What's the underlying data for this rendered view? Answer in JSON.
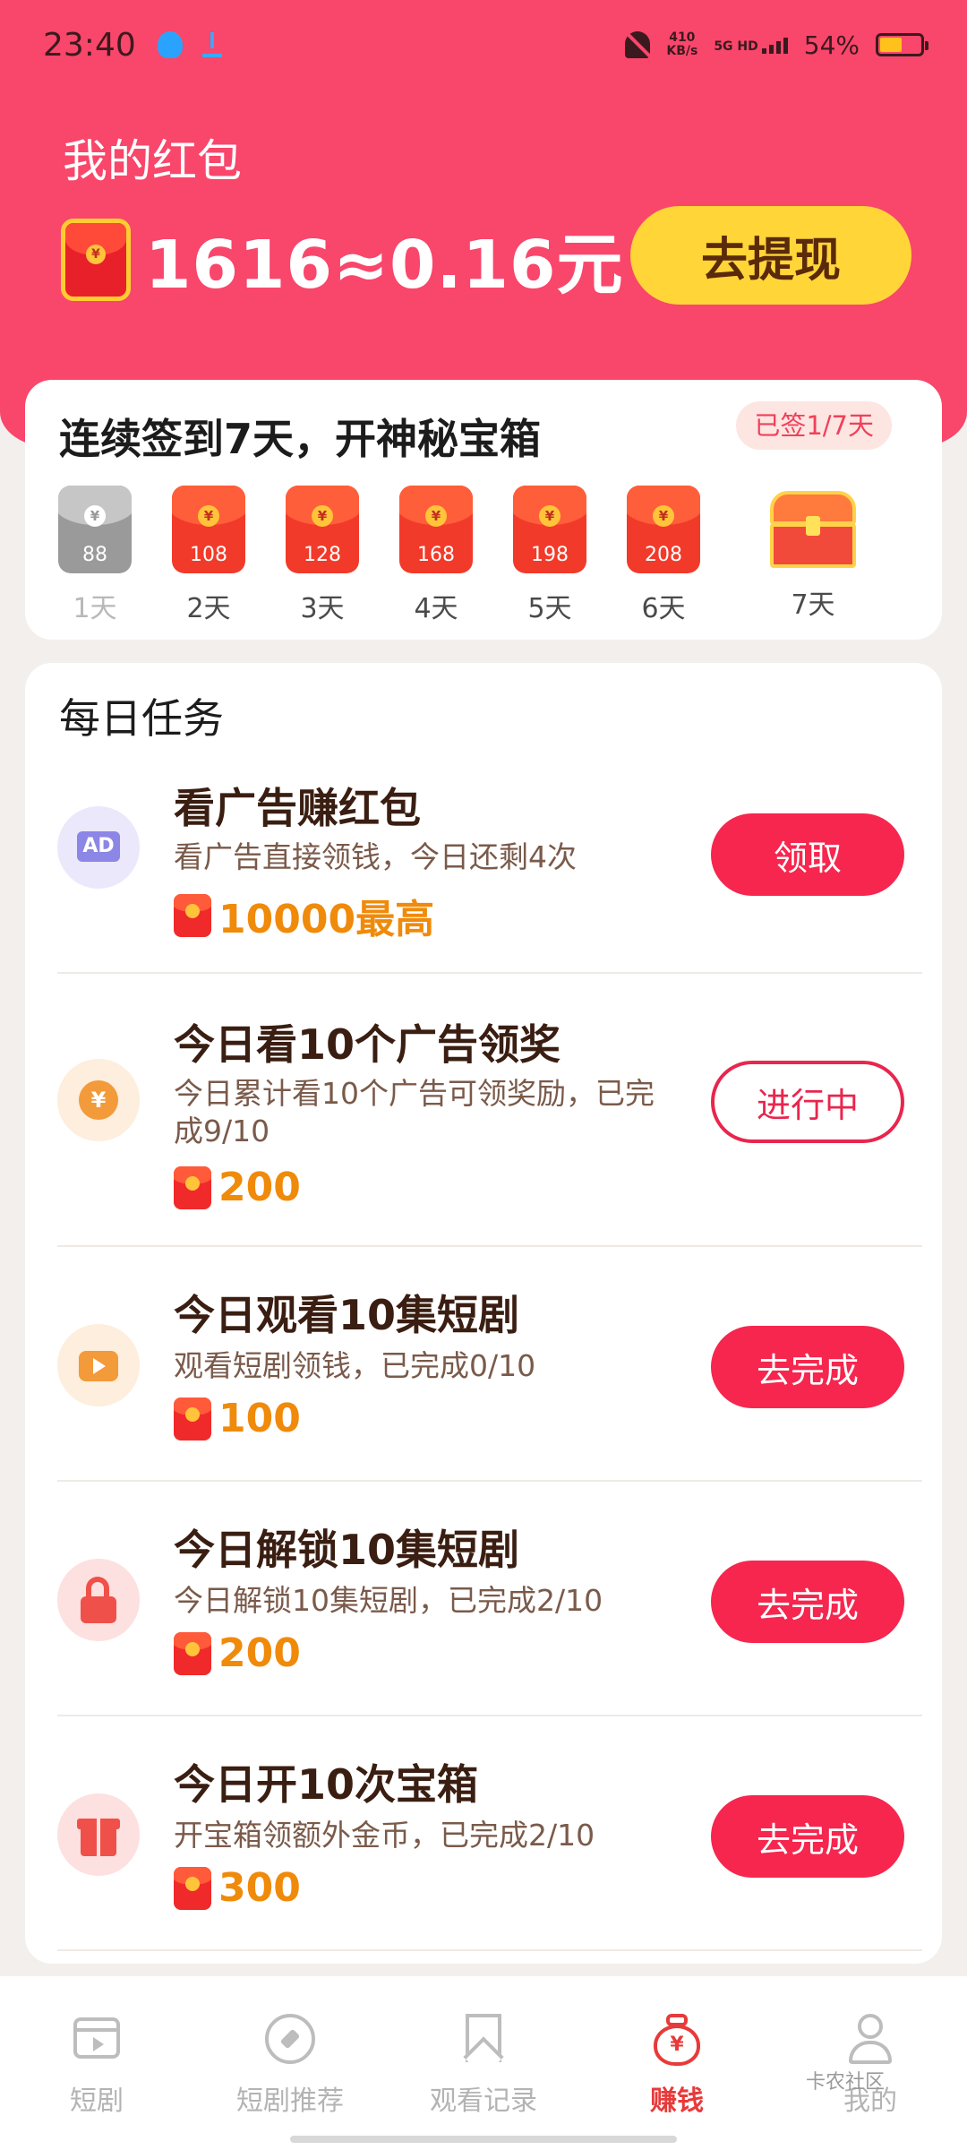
{
  "status_bar": {
    "time": "23:40",
    "net_speed_top": "410",
    "net_speed_bottom": "KB/s",
    "signal": "5G HD",
    "battery": "54%"
  },
  "wallet": {
    "title": "我的红包",
    "amount": "1616≈0.16元",
    "withdraw_label": "去提现"
  },
  "checkin": {
    "title": "连续签到7天，开神秘宝箱",
    "badge": "已签1/7天",
    "days": [
      {
        "value": "88",
        "label": "1天"
      },
      {
        "value": "108",
        "label": "2天"
      },
      {
        "value": "128",
        "label": "3天"
      },
      {
        "value": "168",
        "label": "4天"
      },
      {
        "value": "198",
        "label": "5天"
      },
      {
        "value": "208",
        "label": "6天"
      },
      {
        "value": "",
        "label": "7天"
      }
    ]
  },
  "tasks": {
    "title": "每日任务",
    "items": [
      {
        "name": "看广告赚红包",
        "desc": "看广告直接领钱，今日还剩4次",
        "reward": "10000最高",
        "button": "领取",
        "icon": "ad-icon"
      },
      {
        "name": "今日看10个广告领奖",
        "desc": "今日累计看10个广告可领奖励，已完成9/10",
        "reward": "200",
        "button": "进行中",
        "icon": "yen-coin-icon"
      },
      {
        "name": "今日观看10集短剧",
        "desc": "观看短剧领钱，已完成0/10",
        "reward": "100",
        "button": "去完成",
        "icon": "tv-icon"
      },
      {
        "name": "今日解锁10集短剧",
        "desc": "今日解锁10集短剧，已完成2/10",
        "reward": "200",
        "button": "去完成",
        "icon": "unlock-icon"
      },
      {
        "name": "今日开10次宝箱",
        "desc": "开宝箱领额外金币，已完成2/10",
        "reward": "300",
        "button": "去完成",
        "icon": "gift-icon"
      }
    ]
  },
  "tab_bar": {
    "tabs": [
      {
        "label": "短剧",
        "icon": "film-icon"
      },
      {
        "label": "短剧推荐",
        "icon": "compass-icon"
      },
      {
        "label": "观看记录",
        "icon": "bookmark-icon"
      },
      {
        "label": "赚钱",
        "icon": "money-bag-icon"
      },
      {
        "label": "我的",
        "icon": "user-icon"
      }
    ],
    "active": "赚钱"
  },
  "watermark": "卡农社区",
  "colors": {
    "header": "#f9466b",
    "accent": "#f6264e",
    "withdraw_button": "#ffd538",
    "reward": "#f08a0a"
  }
}
